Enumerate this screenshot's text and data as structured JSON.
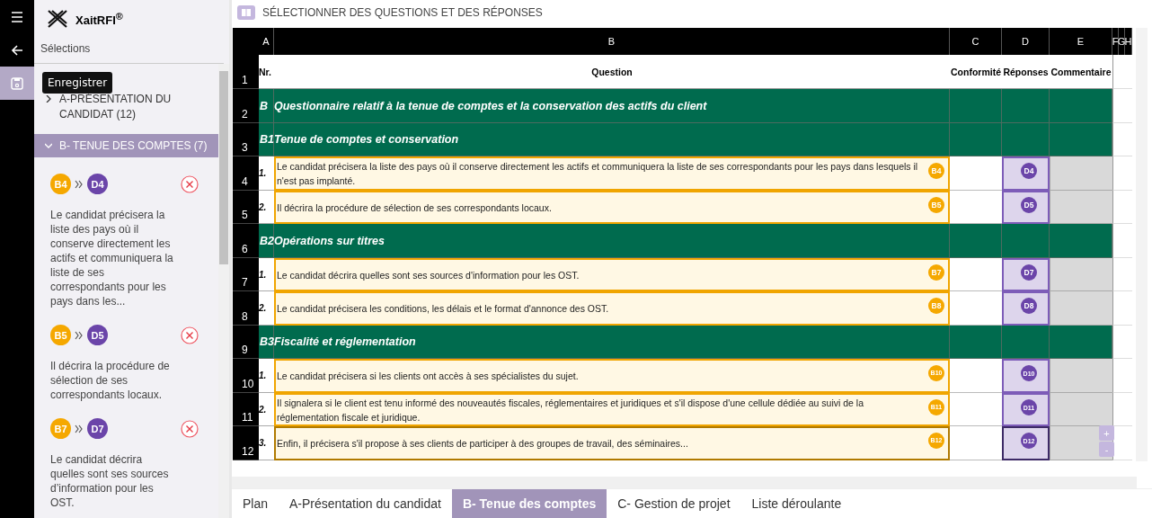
{
  "nav_rail": {
    "items": [
      {
        "kind": "menu",
        "selected": false
      },
      {
        "kind": "back",
        "selected": false
      },
      {
        "kind": "save",
        "selected": true
      }
    ]
  },
  "tooltip": {
    "text": "Enregistrer"
  },
  "sidebar": {
    "logo": "XaitRFI$^{®}$",
    "heading": "Sélections",
    "groups": [
      {
        "label": "A-PRÉSENTATION DU CANDIDAT (12)",
        "expanded": false
      },
      {
        "label": "B- TENUE DES COMPTES (7)",
        "expanded": true,
        "selections": [
          {
            "question": "B4",
            "answer": "D4",
            "text": "Le candidat précisera la liste des pays où il conserve directement les actifs et communiquera la liste de ses correspondants pour les pays dans les..."
          },
          {
            "question": "B5",
            "answer": "D5",
            "text": "Il décrira la procédure de sélection de ses correspondants locaux."
          },
          {
            "question": "B7",
            "answer": "D7",
            "text": "Le candidat décrira quelles sont ses sources d’information pour les OST."
          }
        ]
      }
    ]
  },
  "panel": {
    "title": "SÉLECTIONNER DES QUESTIONS ET DES RÉPONSES"
  },
  "sheet": {
    "columns": [
      "A",
      "B",
      "C",
      "D",
      "E",
      "F",
      "G",
      "H"
    ],
    "header_row": {
      "number": "1",
      "cells": [
        "Nr.",
        "Question",
        "Conformité",
        "Réponses",
        "Commentaire"
      ]
    },
    "rows": [
      {
        "number": "2",
        "kind": "section",
        "code": "B",
        "title": "Questionnaire relatif à la tenue de comptes et la conservation des actifs du client"
      },
      {
        "number": "3",
        "kind": "section",
        "code": "B1",
        "title": "Tenue de comptes et conservation"
      },
      {
        "number": "4",
        "kind": "question",
        "nr": "1.",
        "text": "Le candidat précisera la liste des pays où il conserve directement les actifs et communiquera la liste de ses correspondants pour les pays dans lesquels il n'est pas implanté.",
        "question_badge": "B4",
        "answer_badge": "D4",
        "focused": false
      },
      {
        "number": "5",
        "kind": "question",
        "nr": "2.",
        "text": "Il décrira la procédure de sélection de ses correspondants locaux.",
        "question_badge": "B5",
        "answer_badge": "D5",
        "focused": false
      },
      {
        "number": "6",
        "kind": "section",
        "code": "B2",
        "title": "Opérations sur titres"
      },
      {
        "number": "7",
        "kind": "question",
        "nr": "1.",
        "text": "Le candidat décrira quelles sont ses sources d'information pour les OST.",
        "question_badge": "B7",
        "answer_badge": "D7",
        "focused": false
      },
      {
        "number": "8",
        "kind": "question",
        "nr": "2.",
        "text": "Le candidat précisera les conditions, les délais et le format d'annonce des OST.",
        "question_badge": "B8",
        "answer_badge": "D8",
        "focused": false
      },
      {
        "number": "9",
        "kind": "section",
        "code": "B3",
        "title": "Fiscalité et réglementation"
      },
      {
        "number": "10",
        "kind": "question",
        "nr": "1.",
        "text": "Le candidat précisera si les clients ont accès à ses spécialistes du sujet.",
        "question_badge": "B10",
        "answer_badge": "D10",
        "focused": false
      },
      {
        "number": "11",
        "kind": "question",
        "nr": "2.",
        "text": "Il signalera si le client est tenu informé des nouveautés fiscales, réglementaires et juridiques et s'il dispose d'une cellule dédiée au suivi de la réglementation fiscale et juridique.",
        "question_badge": "B11",
        "answer_badge": "D11",
        "focused": false
      },
      {
        "number": "12",
        "kind": "question",
        "nr": "3.",
        "text": "Enfin, il précisera s'il propose à ses clients de participer à des groupes de travail, des séminaires...",
        "question_badge": "B12",
        "answer_badge": "D12",
        "focused": true
      }
    ]
  },
  "zoom_controls": [
    "+",
    "-"
  ],
  "tabs": [
    {
      "label": "Plan",
      "selected": false
    },
    {
      "label": "A-Présentation du candidat",
      "selected": false
    },
    {
      "label": "B- Tenue des comptes",
      "selected": true
    },
    {
      "label": "C- Gestion de projet",
      "selected": false
    },
    {
      "label": "Liste déroulante",
      "selected": false
    }
  ]
}
